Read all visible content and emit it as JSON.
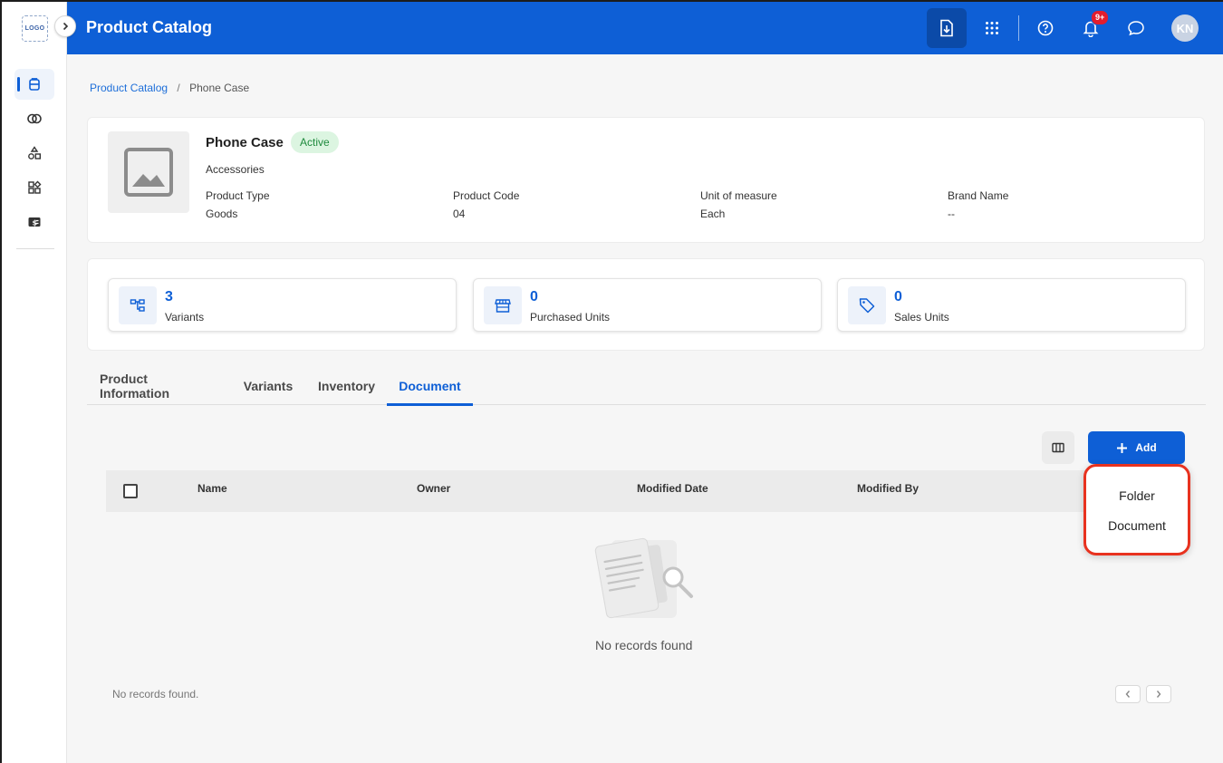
{
  "app": {
    "logo_text": "LOGO",
    "title": "Product Catalog",
    "notification_count": "9+",
    "user_initials": "KN"
  },
  "sidebar": {
    "items": [
      {
        "icon": "catalog-icon",
        "active": true
      },
      {
        "icon": "link-rings-icon",
        "active": false
      },
      {
        "icon": "shapes-icon",
        "active": false
      },
      {
        "icon": "apps-grid-icon",
        "active": false
      },
      {
        "icon": "billing-icon",
        "active": false
      }
    ]
  },
  "breadcrumb": {
    "root": "Product Catalog",
    "separator": "/",
    "current": "Phone Case"
  },
  "product": {
    "name": "Phone Case",
    "status": "Active",
    "category": "Accessories",
    "attributes": [
      {
        "label": "Product Type",
        "value": "Goods"
      },
      {
        "label": "Product Code",
        "value": "04"
      },
      {
        "label": "Unit of measure",
        "value": "Each"
      },
      {
        "label": "Brand Name",
        "value": "--"
      }
    ]
  },
  "stats": [
    {
      "value": "3",
      "label": "Variants",
      "icon": "hierarchy-icon"
    },
    {
      "value": "0",
      "label": "Purchased Units",
      "icon": "store-icon"
    },
    {
      "value": "0",
      "label": "Sales Units",
      "icon": "tag-icon"
    }
  ],
  "tabs": [
    {
      "label": "Product Information",
      "active": false
    },
    {
      "label": "Variants",
      "active": false
    },
    {
      "label": "Inventory",
      "active": false
    },
    {
      "label": "Document",
      "active": true
    }
  ],
  "toolbar": {
    "add_label": "Add"
  },
  "table": {
    "columns": [
      "Name",
      "Owner",
      "Modified Date",
      "Modified By"
    ],
    "empty_message": "No records found",
    "footer_message": "No records found."
  },
  "add_menu": {
    "items": [
      "Folder",
      "Document"
    ]
  },
  "colors": {
    "primary": "#0e5fd6",
    "header_dark": "#0b4aa8",
    "status_bg": "#dcf5e1",
    "status_text": "#1f8a3d",
    "highlight_outline": "#e8321f",
    "badge": "#e11d2e"
  }
}
